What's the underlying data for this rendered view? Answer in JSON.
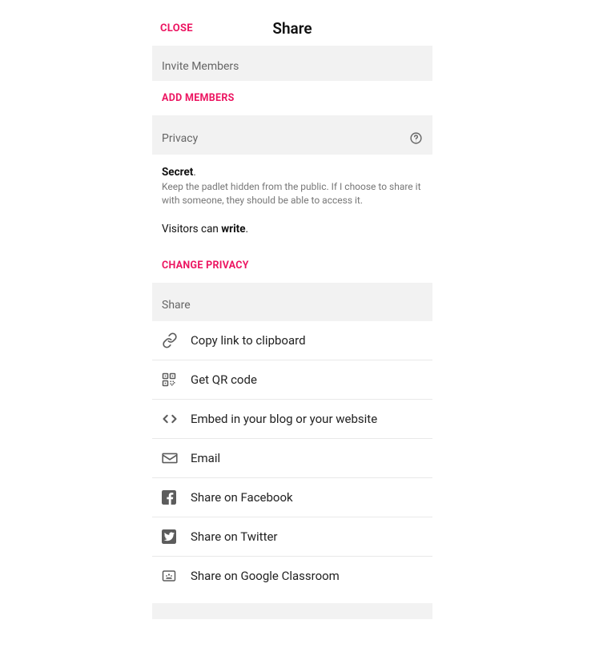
{
  "header": {
    "close": "CLOSE",
    "title": "Share"
  },
  "sections": {
    "invite": "Invite Members",
    "privacy": "Privacy",
    "share": "Share"
  },
  "actions": {
    "add_members": "ADD MEMBERS",
    "change_privacy": "CHANGE PRIVACY"
  },
  "privacy": {
    "title": "Secret",
    "dot": ".",
    "desc": "Keep the padlet hidden from the public. If I choose to share it with someone, they should be able to access it.",
    "visitors_pre": "Visitors can ",
    "visitors_perm": "write",
    "visitors_post": "."
  },
  "share_items": [
    {
      "label": "Copy link to clipboard"
    },
    {
      "label": "Get QR code"
    },
    {
      "label": "Embed in your blog or your website"
    },
    {
      "label": "Email"
    },
    {
      "label": "Share on Facebook"
    },
    {
      "label": "Share on Twitter"
    },
    {
      "label": "Share on Google Classroom"
    }
  ],
  "colors": {
    "accent": "#ec1561"
  }
}
